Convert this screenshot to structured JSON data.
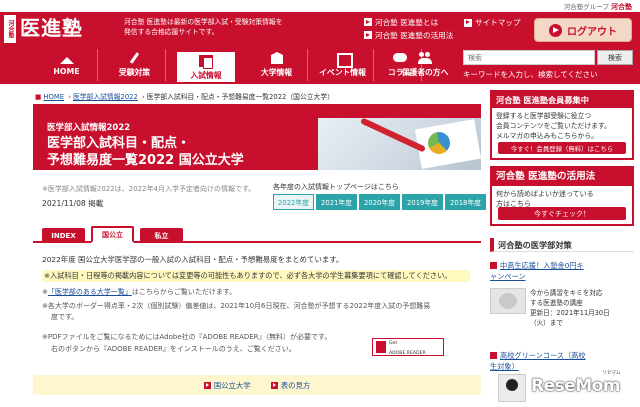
{
  "topbar": {
    "group_text": "河合塾グループ",
    "group_brand": "河合塾"
  },
  "header": {
    "logo_small": "河合塾",
    "logo_main": "医進塾",
    "tagline_1": "河合塾 医進塾は最新の医学部入試・受験対策情報を",
    "tagline_2": "発信する合格応援サイトです。",
    "link_about": "河合塾 医進塾とは",
    "link_howto": "河合塾 医進塾の活用法",
    "link_sitemap": "サイトマップ",
    "logout_label": "ログアウト"
  },
  "nav": {
    "items": [
      {
        "label": "HOME",
        "icon": "home-icon"
      },
      {
        "label": "受験対策",
        "icon": "pen-icon"
      },
      {
        "label": "入試情報",
        "icon": "document-icon"
      },
      {
        "label": "大学情報",
        "icon": "building-icon"
      },
      {
        "label": "イベント情報",
        "icon": "calendar-icon"
      },
      {
        "label": "コラム",
        "icon": "chat-icon"
      },
      {
        "label": "保護者の方へ",
        "icon": "people-icon"
      }
    ],
    "search_placeholder": "検索",
    "search_button": "検索",
    "search_hint": "キーワードを入力し、検索してください"
  },
  "breadcrumb": {
    "home": "HOME",
    "level1": "医学部入試情報2022",
    "current": "医学部入試科目・配点・予想難易度一覧2022（国公立大学）"
  },
  "banner": {
    "subtitle": "医学部入試情報2022",
    "title_1": "医学部入試科目・配点・",
    "title_2": "予想難易度一覧2022 国公立大学"
  },
  "meta": {
    "note": "※医学部入試情報2022は、2022年4月入学予定者向けの情報です。",
    "date": "2021/11/08 掲載",
    "year_heading": "各年度の入試情報トップページはこちら",
    "years": [
      "2022年度",
      "2021年度",
      "2020年度",
      "2019年度",
      "2018年度"
    ]
  },
  "tabs": [
    "INDEX",
    "国公立",
    "私立"
  ],
  "content": {
    "lead": "2022年度 国公立大学医学部の一般入試の入試科目・配点・予想難易度をまとめています。",
    "warning": "※入試科目・日程等の掲載内容については変更等の可能性もありますので、必ず各大学の学生募集要項にて確認してください。",
    "item1_link": "「医学部のある大学一覧」",
    "item1_rest": "はこちらからご覧いただけます。",
    "item2_a": "※各大学のボーダー得点率・2次（個別試験）偏差値は、2021年10月6日現在、河合塾が予想する2022年度入試の予想難易",
    "item2_b": "度です。",
    "item3_a": "※PDFファイルをご覧になるためにはAdobe社の『ADOBE READER』（無料）が必要です。",
    "item3_b": "右のボタンから『ADOBE READER』をインストールのうえ、ご覧ください。",
    "reader_top": "Get",
    "reader_label": "ADOBE READER",
    "bottom_link1": "国公立大学",
    "bottom_link2": "表の見方"
  },
  "sidebar": {
    "member_title": "河合塾 医進塾会員募集中",
    "member_body_1": "登録すると医学部受験に役立つ",
    "member_body_2": "会員コンテンツをご覧いただけます。",
    "member_body_3": "メルマガの申込みもこちらから。",
    "member_button": "今すぐ！会員登録（無料）はこちら",
    "howto_title": "河合塾 医進塾の活用法",
    "howto_body_1": "何から読めばよいか迷っている",
    "howto_body_2": "方はこちら",
    "howto_button": "今すぐチェック！",
    "section_title": "河合塾の医学部対策",
    "news1_a": "中高生応援！入塾金0円キ",
    "news1_b": "ャンペーン",
    "news2_a": "今から講習をキミを対応",
    "news2_b": "する医進塾の講座",
    "news2_date": "更新日：2021年11月30日",
    "news2_day": "（火）まで",
    "news3_a": "高校グリーンコース（高校",
    "news3_b": "生対象）"
  },
  "watermark": {
    "text": "ReseMom",
    "small": "リセマム"
  },
  "colors": {
    "brand_red": "#c8102e",
    "teal": "#2ba3a8",
    "highlight": "#fff9c0"
  }
}
